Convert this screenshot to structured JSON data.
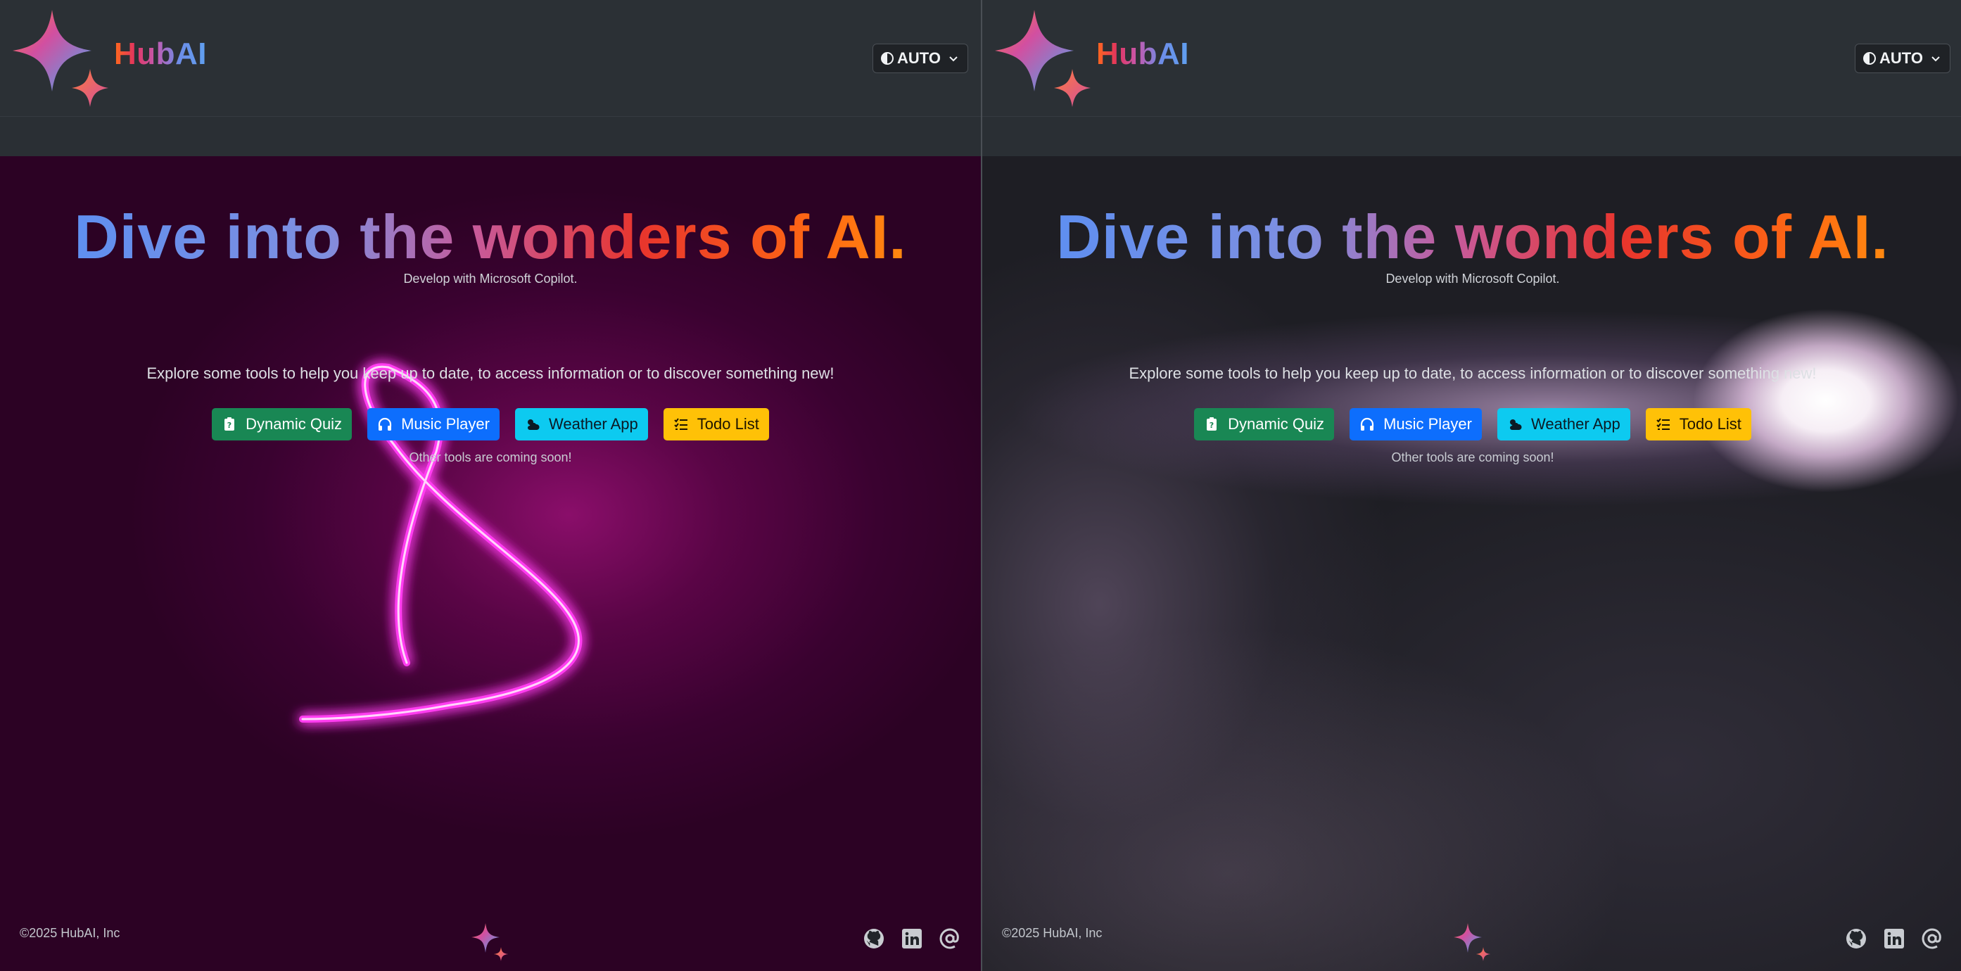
{
  "brand": {
    "name": "HubAI"
  },
  "theme": {
    "label": "AUTO"
  },
  "hero": {
    "headline": "Dive into the wonders of AI.",
    "subtitle": "Develop with Microsoft Copilot.",
    "explore": "Explore some tools to help you keep up to date, to access information or to discover something new!",
    "tools": [
      {
        "label": "Dynamic Quiz",
        "icon": "clipboard-question-icon",
        "color": "#198754"
      },
      {
        "label": "Music Player",
        "icon": "headphones-icon",
        "color": "#0d6efd"
      },
      {
        "label": "Weather App",
        "icon": "cloud-sun-icon",
        "color": "#0dcaf0"
      },
      {
        "label": "Todo List",
        "icon": "list-check-icon",
        "color": "#ffc107"
      }
    ],
    "coming_soon": "Other tools are coming soon!"
  },
  "footer": {
    "copyright": "©2025 HubAI, Inc",
    "links": [
      "github-icon",
      "linkedin-icon",
      "at-sign-icon"
    ]
  },
  "panes": [
    {
      "name": "left",
      "background": "neon-magenta"
    },
    {
      "name": "right",
      "background": "smoke-dark"
    }
  ]
}
